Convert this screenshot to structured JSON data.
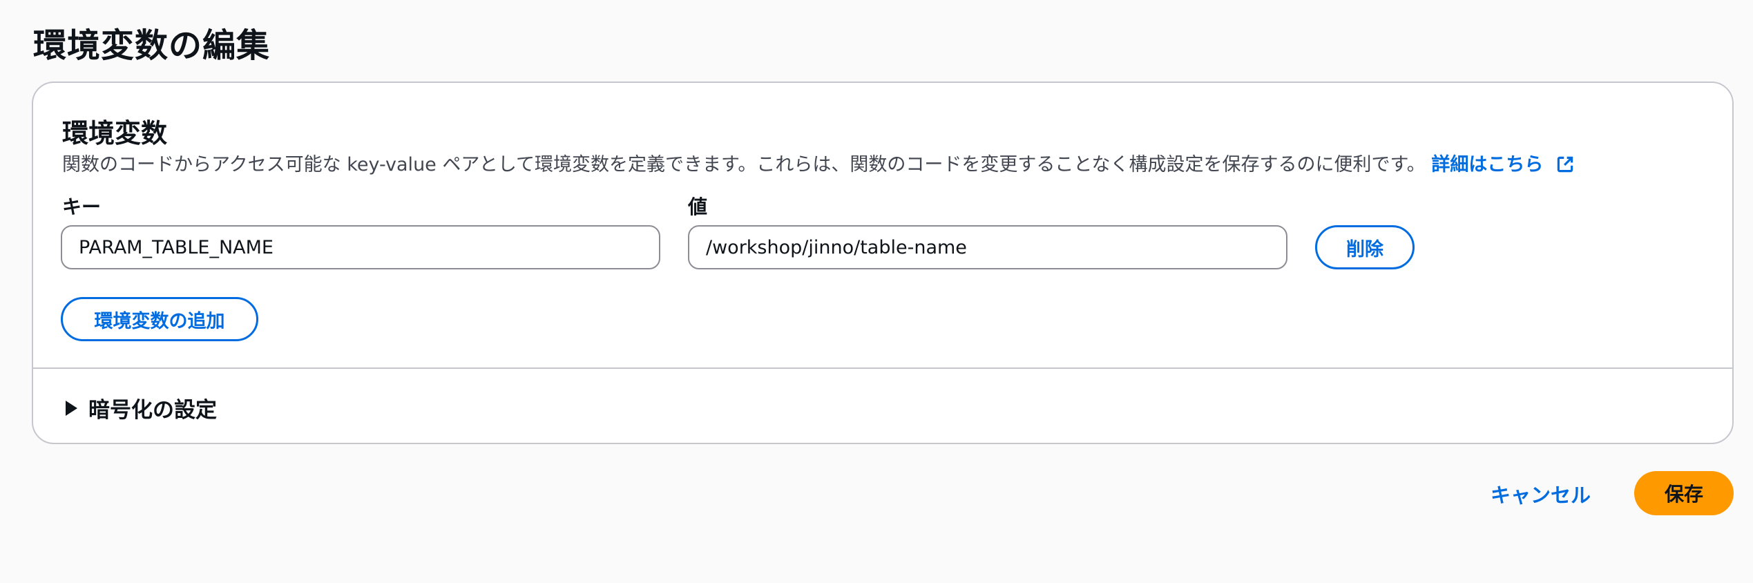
{
  "page": {
    "title": "環境変数の編集"
  },
  "panel": {
    "title": "環境変数",
    "description": "関数のコードからアクセス可能な key-value ペアとして環境変数を定義できます。これらは、関数のコードを変更することなく構成設定を保存するのに便利です。",
    "learn_more": "詳細はこちら",
    "key_label": "キー",
    "value_label": "値",
    "variables": [
      {
        "key": "PARAM_TABLE_NAME",
        "value": "/workshop/jinno/table-name",
        "remove_label": "削除"
      }
    ],
    "add_label": "環境変数の追加",
    "encryption_label": "暗号化の設定"
  },
  "footer": {
    "cancel_label": "キャンセル",
    "save_label": "保存"
  },
  "colors": {
    "link": "#006ce0",
    "primary_button": "#ff9900",
    "border": "#c6c6cd",
    "background": "#fafafa"
  },
  "icons": [
    "external-link-icon",
    "caret-right-icon"
  ]
}
